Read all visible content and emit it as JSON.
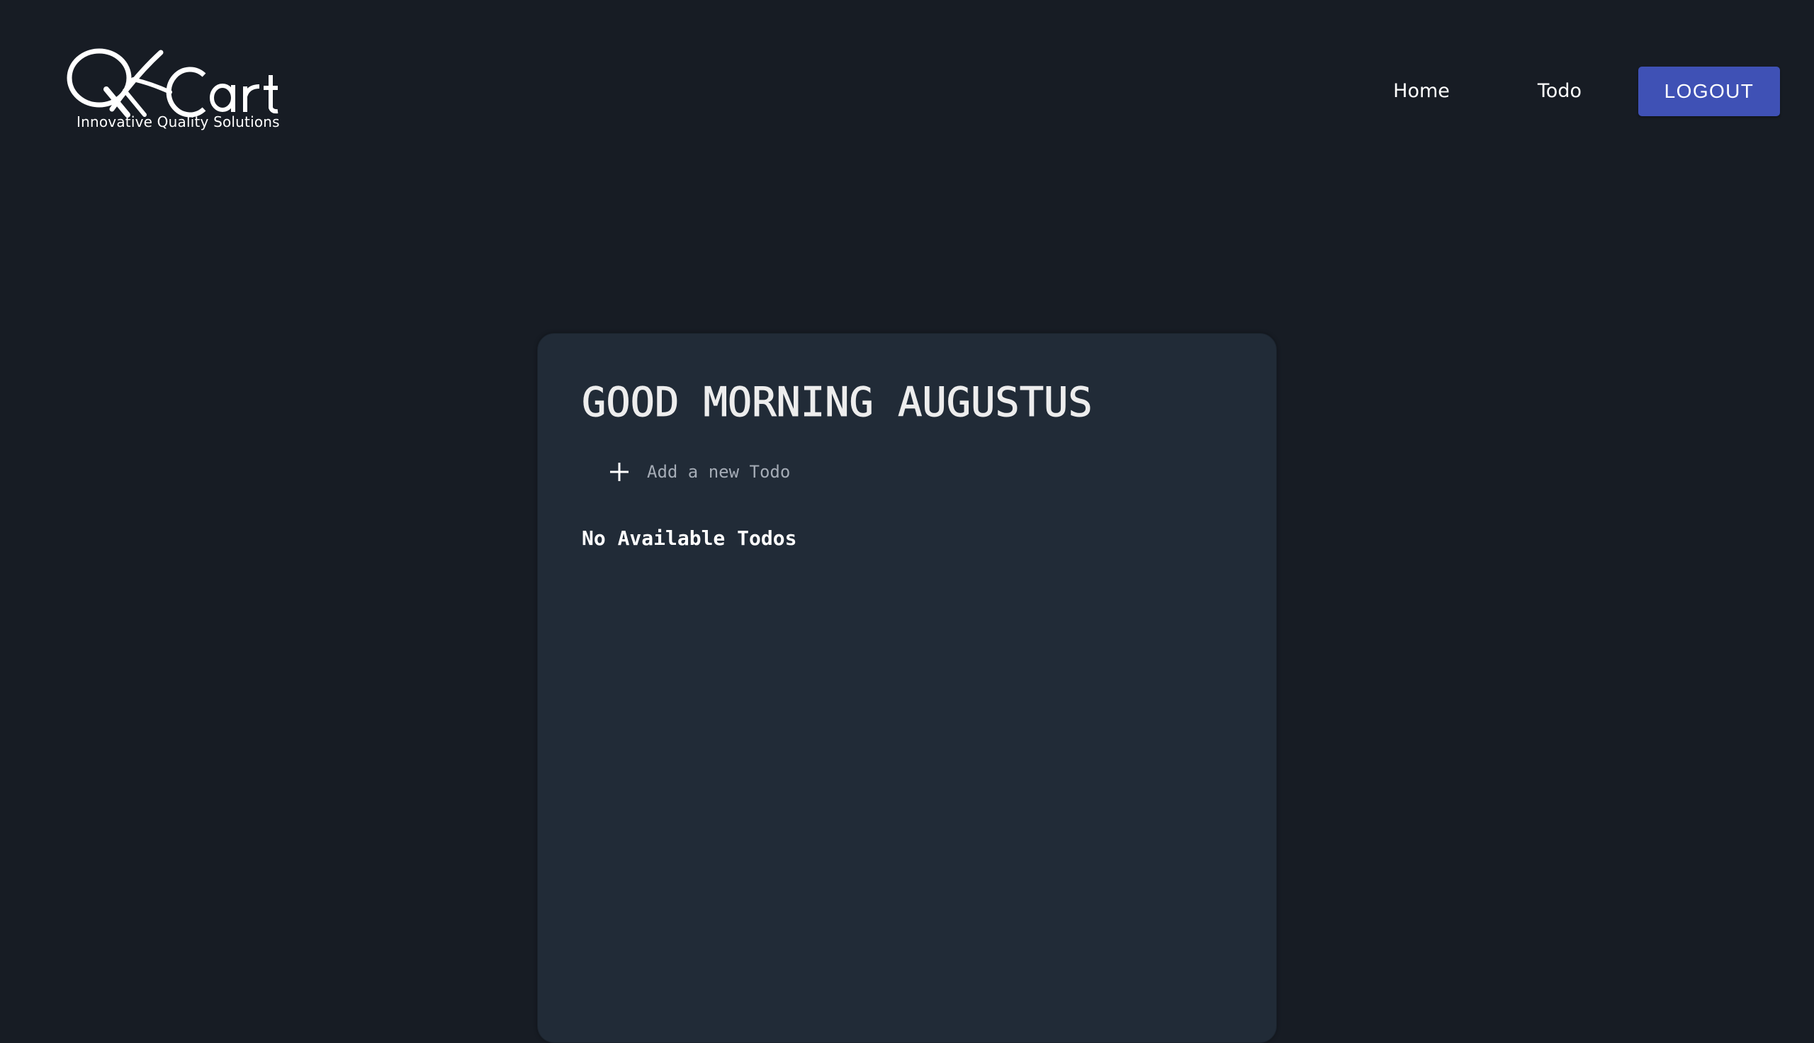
{
  "header": {
    "logo": {
      "wordmark": "QACart",
      "tagline": "Innovative Quality Solutions"
    },
    "nav": {
      "home_label": "Home",
      "todo_label": "Todo",
      "logout_label": "LOGOUT"
    }
  },
  "main": {
    "greeting": "GOOD MORNING AUGUSTUS",
    "add_todo": {
      "placeholder": "Add a new Todo",
      "value": ""
    },
    "empty_message": "No Available Todos"
  },
  "colors": {
    "background": "#171c24",
    "card": "#212b37",
    "accent": "#3f51b5",
    "text": "#ffffff",
    "placeholder": "#a5acb6"
  },
  "icons": {
    "add": "plus-icon",
    "logo": "qacart-logo"
  }
}
